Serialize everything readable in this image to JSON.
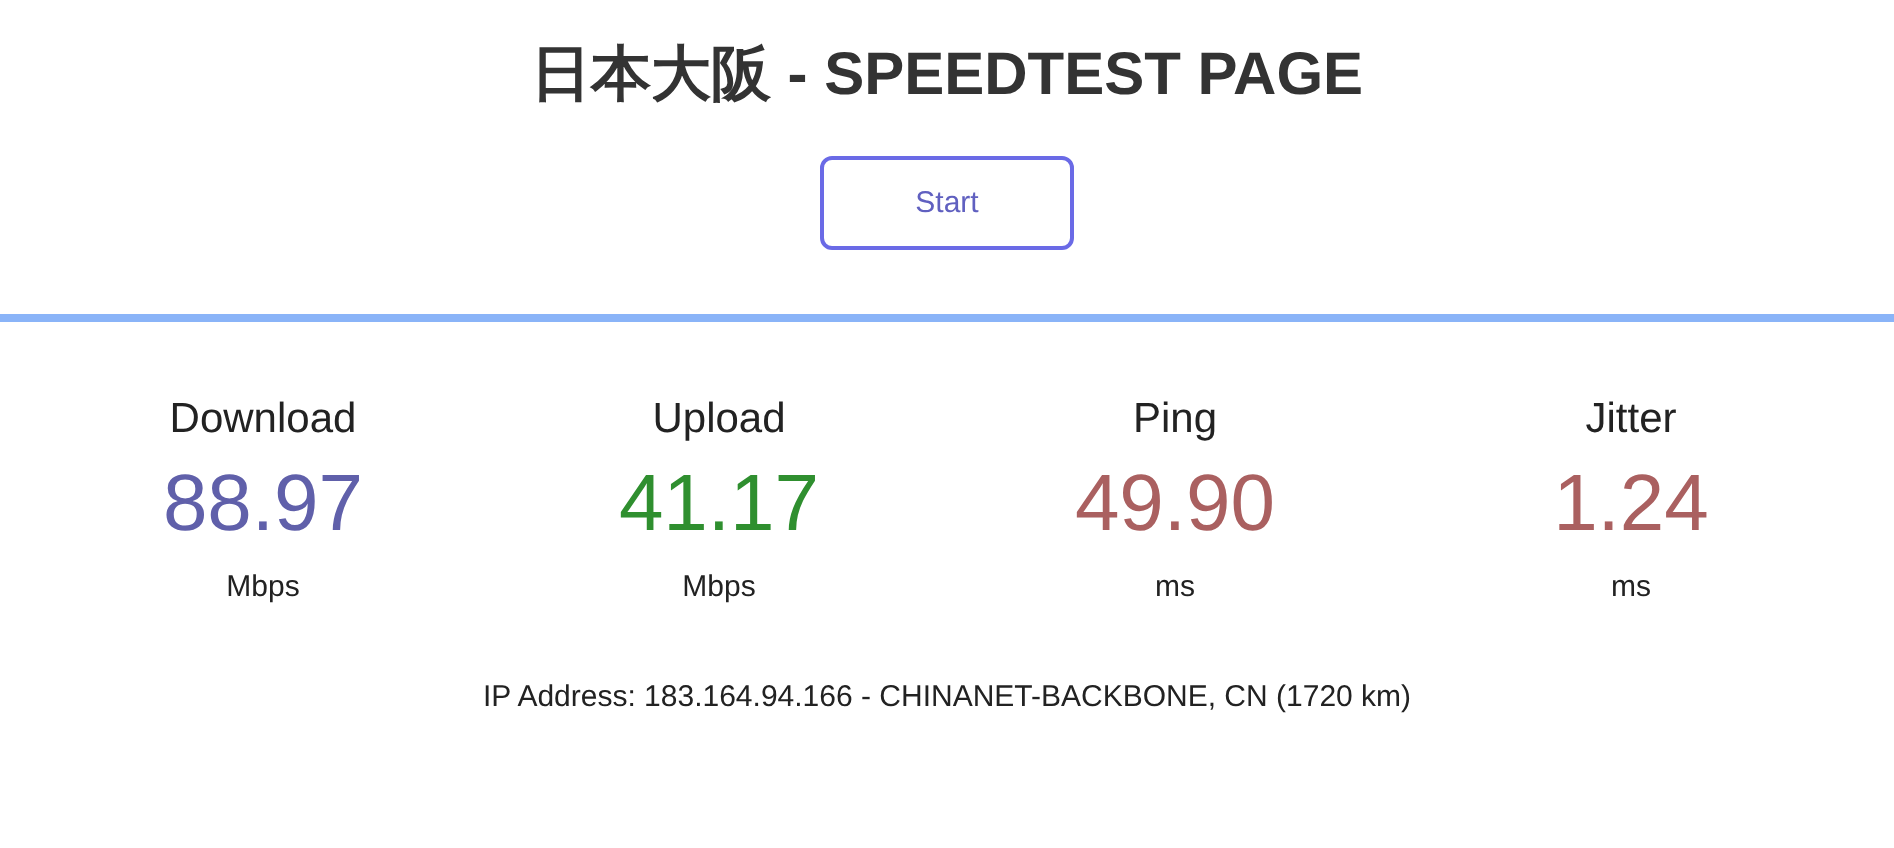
{
  "title": "日本大阪 - SPEEDTEST PAGE",
  "start_button": {
    "label": "Start"
  },
  "metrics": [
    {
      "label": "Download",
      "value": "88.97",
      "unit": "Mbps",
      "color": "#6060aa"
    },
    {
      "label": "Upload",
      "value": "41.17",
      "unit": "Mbps",
      "color": "#2f8f2f"
    },
    {
      "label": "Ping",
      "value": "49.90",
      "unit": "ms",
      "color": "#aa6060"
    },
    {
      "label": "Jitter",
      "value": "1.24",
      "unit": "ms",
      "color": "#aa6060"
    }
  ],
  "ip_info": "IP Address: 183.164.94.166 - CHINANET-BACKBONE, CN (1720 km)"
}
